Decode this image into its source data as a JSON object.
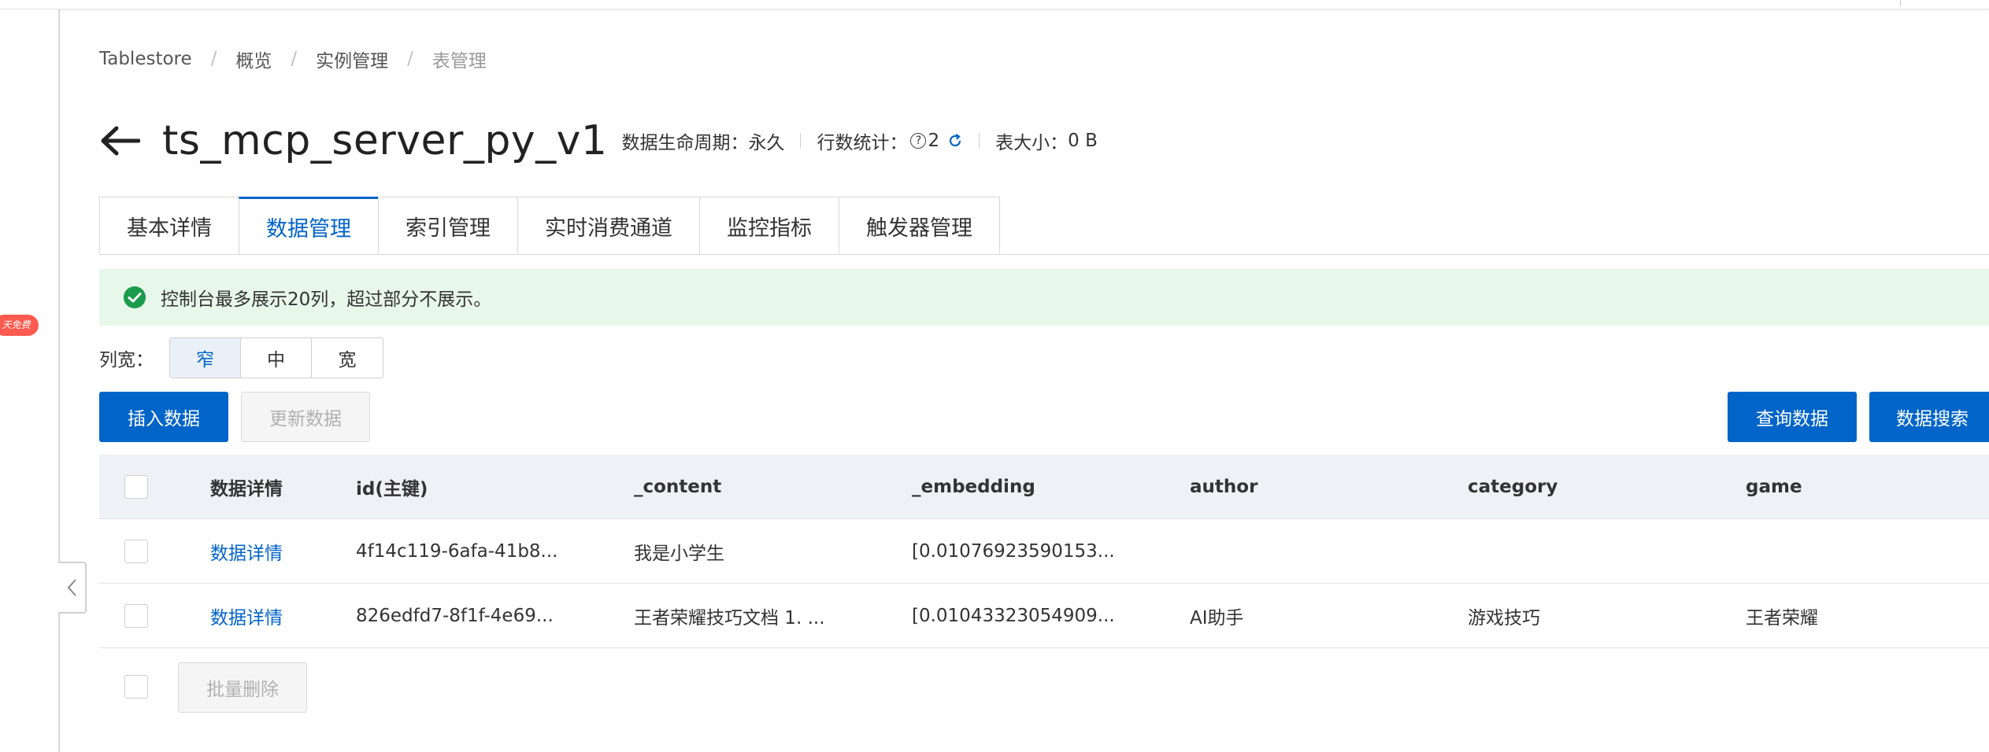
{
  "sidebar": {
    "promo_badge": "天免费"
  },
  "breadcrumb": {
    "items": [
      "Tablestore",
      "概览",
      "实例管理"
    ],
    "current": "表管理",
    "separator": "/"
  },
  "header": {
    "title": "ts_mcp_server_py_v1",
    "lifecycle_label": "数据生命周期：",
    "lifecycle_value": "永久",
    "row_stats_label": "行数统计：",
    "row_stats_value": "2",
    "table_size_label": "表大小：",
    "table_size_value": "0 B"
  },
  "tabs": [
    {
      "label": "基本详情",
      "active": false
    },
    {
      "label": "数据管理",
      "active": true
    },
    {
      "label": "索引管理",
      "active": false
    },
    {
      "label": "实时消费通道",
      "active": false
    },
    {
      "label": "监控指标",
      "active": false
    },
    {
      "label": "触发器管理",
      "active": false
    }
  ],
  "alert": {
    "message": "控制台最多展示20列，超过部分不展示。",
    "color": "#e7f7ea"
  },
  "column_width": {
    "label": "列宽：",
    "options": [
      "窄",
      "中",
      "宽"
    ],
    "selected": "窄"
  },
  "toolbar": {
    "insert_label": "插入数据",
    "update_label": "更新数据",
    "query_label": "查询数据",
    "search_label": "数据搜索"
  },
  "table": {
    "headers": [
      "数据详情",
      "id(主键)",
      "_content",
      "_embedding",
      "author",
      "category",
      "game"
    ],
    "rows": [
      [
        "数据详情",
        "4f14c119-6afa-41b8...",
        "我是小学生",
        "[0.01076923590153...",
        "",
        "",
        ""
      ],
      [
        "数据详情",
        "826edfd7-8f1f-4e69...",
        "王者荣耀技巧文档 1. ...",
        "[0.01043323054909...",
        "AI助手",
        "游戏技巧",
        "王者荣耀"
      ]
    ],
    "batch_delete_label": "批量删除"
  },
  "colors": {
    "accent": "#0064c8",
    "success": "#1a9b4b",
    "badge": "#ff5a4f"
  }
}
